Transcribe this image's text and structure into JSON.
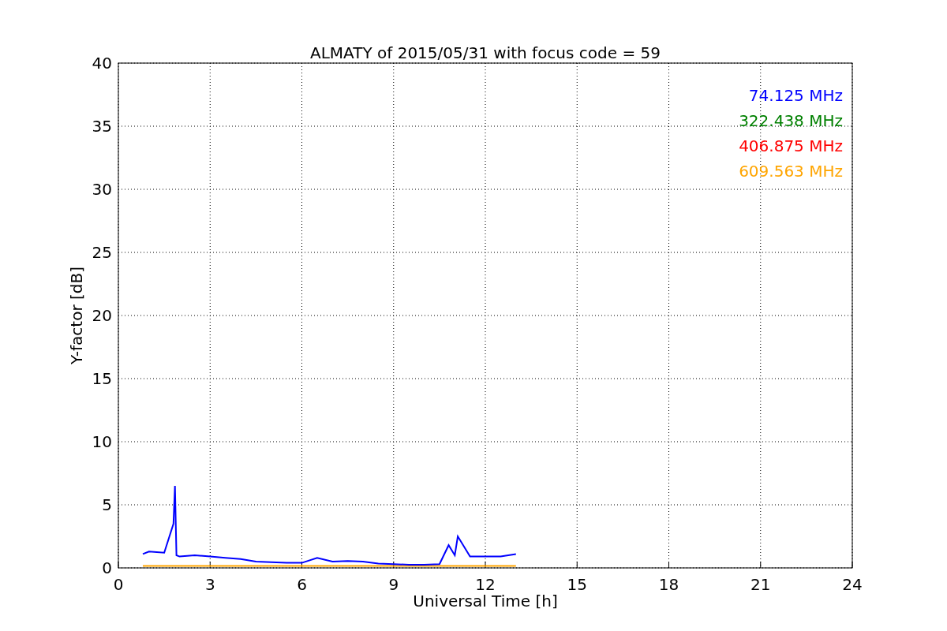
{
  "chart_data": {
    "type": "line",
    "title": "ALMATY of 2015/05/31 with focus code = 59",
    "xlabel": "Universal Time [h]",
    "ylabel": "Y-factor [dB]",
    "x": [
      0.8,
      1.0,
      1.5,
      1.8,
      1.85,
      1.9,
      2.0,
      2.5,
      3.0,
      3.5,
      4.0,
      4.5,
      5.0,
      5.5,
      6.0,
      6.5,
      7.0,
      7.5,
      8.0,
      8.5,
      9.0,
      9.5,
      10.0,
      10.5,
      10.8,
      11.0,
      11.1,
      11.5,
      12.0,
      12.5,
      13.0
    ],
    "series": [
      {
        "name": "74.125 MHz",
        "color": "#0000ff",
        "values": [
          1.1,
          1.3,
          1.2,
          3.5,
          6.5,
          1.0,
          0.9,
          1.0,
          0.9,
          0.8,
          0.7,
          0.5,
          0.45,
          0.4,
          0.4,
          0.8,
          0.5,
          0.55,
          0.5,
          0.35,
          0.3,
          0.25,
          0.25,
          0.3,
          1.8,
          1.0,
          2.5,
          0.9,
          0.9,
          0.9,
          1.1
        ]
      },
      {
        "name": "322.438 MHz",
        "color": "#008000",
        "values": [
          null,
          null,
          null,
          null,
          null,
          null,
          null,
          null,
          null,
          null,
          null,
          null,
          null,
          null,
          null,
          null,
          null,
          null,
          null,
          null,
          null,
          null,
          null,
          null,
          null,
          null,
          null,
          null,
          null,
          null,
          null
        ]
      },
      {
        "name": "406.875 MHz",
        "color": "#ff0000",
        "values": [
          null,
          null,
          null,
          null,
          null,
          null,
          null,
          null,
          null,
          null,
          null,
          null,
          null,
          null,
          null,
          null,
          null,
          null,
          null,
          null,
          null,
          null,
          null,
          null,
          null,
          null,
          null,
          null,
          null,
          null,
          null
        ]
      },
      {
        "name": "609.563 MHz",
        "color": "#ffa500",
        "values": [
          0.15,
          0.15,
          0.15,
          0.15,
          0.15,
          0.15,
          0.15,
          0.15,
          0.15,
          0.15,
          0.15,
          0.15,
          0.15,
          0.15,
          0.15,
          0.15,
          0.15,
          0.15,
          0.15,
          0.15,
          0.15,
          0.15,
          0.15,
          0.15,
          0.15,
          0.15,
          0.15,
          0.15,
          0.15,
          0.15,
          0.15
        ]
      }
    ],
    "grid": true,
    "xlim": [
      0,
      24
    ],
    "ylim": [
      0,
      40
    ],
    "xticks": [
      0,
      3,
      6,
      9,
      12,
      15,
      18,
      21,
      24
    ],
    "yticks": [
      0,
      5,
      10,
      15,
      20,
      25,
      30,
      35,
      40
    ]
  }
}
